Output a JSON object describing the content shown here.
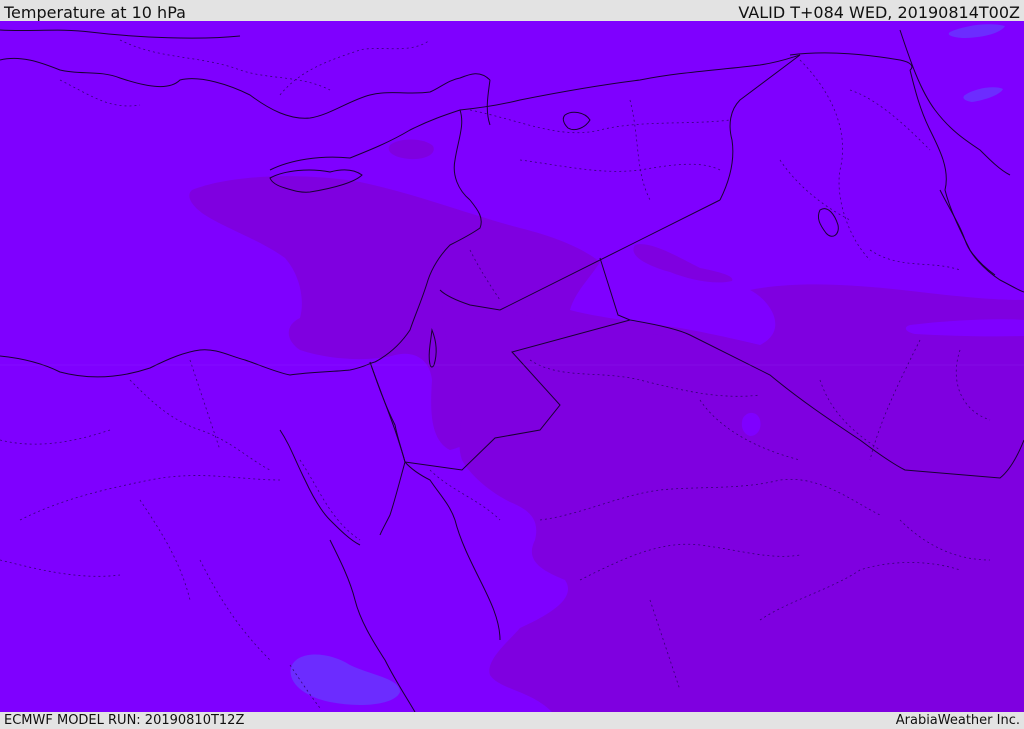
{
  "header": {
    "title": "Temperature at 10 hPa",
    "valid": "VALID T+084 WED, 20190814T00Z"
  },
  "footer": {
    "model_run": "ECMWF MODEL RUN: 20190810T12Z",
    "credit": "ArabiaWeather Inc."
  },
  "map": {
    "colors": {
      "base": "#7f00ff",
      "warm_band": "#7f00e0",
      "cool_patch": "#6c2cff",
      "coastline": "#1a0033",
      "border": "#2a0060"
    }
  }
}
